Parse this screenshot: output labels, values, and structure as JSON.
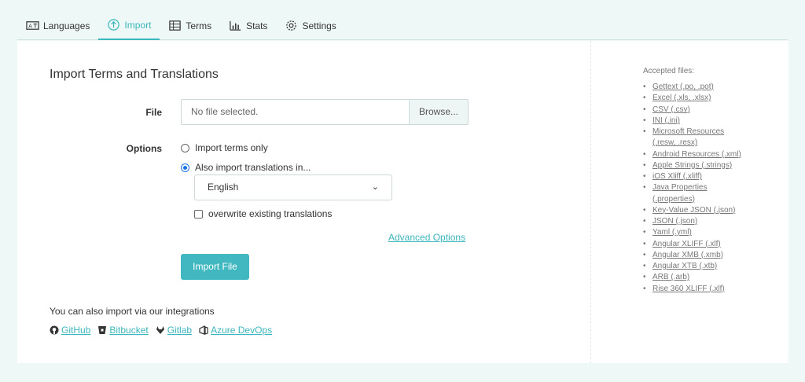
{
  "tabs": [
    {
      "label": "Languages",
      "icon": "languages-icon",
      "active": false
    },
    {
      "label": "Import",
      "icon": "upload-icon",
      "active": true
    },
    {
      "label": "Terms",
      "icon": "table-icon",
      "active": false
    },
    {
      "label": "Stats",
      "icon": "bar-chart-icon",
      "active": false
    },
    {
      "label": "Settings",
      "icon": "gear-icon",
      "active": false
    }
  ],
  "page": {
    "title": "Import Terms and Translations"
  },
  "file": {
    "label": "File",
    "value": "No file selected.",
    "browse_label": "Browse..."
  },
  "options": {
    "label": "Options",
    "radio_terms_only": "Import terms only",
    "radio_also_translations": "Also import translations in...",
    "selected_radio": "also_translations",
    "language_selected": "English",
    "overwrite_label": "overwrite existing translations",
    "overwrite_checked": false
  },
  "advanced_options_label": "Advanced Options",
  "import_button_label": "Import File",
  "integrations": {
    "text": "You can also import via our integrations",
    "links": [
      {
        "label": "GitHub",
        "icon": "github-icon"
      },
      {
        "label": "Bitbucket",
        "icon": "bitbucket-icon"
      },
      {
        "label": "Gitlab",
        "icon": "gitlab-icon"
      },
      {
        "label": "Azure DevOps",
        "icon": "azure-devops-icon"
      }
    ]
  },
  "accepted_files": {
    "title": "Accepted files:",
    "items": [
      "Gettext (.po, .pot)",
      "Excel (.xls, .xlsx)",
      "CSV (.csv)",
      "INI (.ini)",
      "Microsoft Resources",
      "(.resw, .resx)",
      "Android Resources (.xml)",
      "Apple Strings (.strings)",
      "iOS Xliff (.xliff)",
      "Java Properties",
      "(.properties)",
      "Key-Value JSON (.json)",
      "JSON (.json)",
      "Yaml (.yml)",
      "Angular XLIFF (.xlf)",
      "Angular XMB (.xmb)",
      "Angular XTB (.xtb)",
      "ARB (.arb)",
      "Rise 360 XLIFF (.xlf)"
    ]
  },
  "colors": {
    "accent": "#3cb6bd",
    "button": "#41b8c0",
    "background": "#eef8f6"
  }
}
